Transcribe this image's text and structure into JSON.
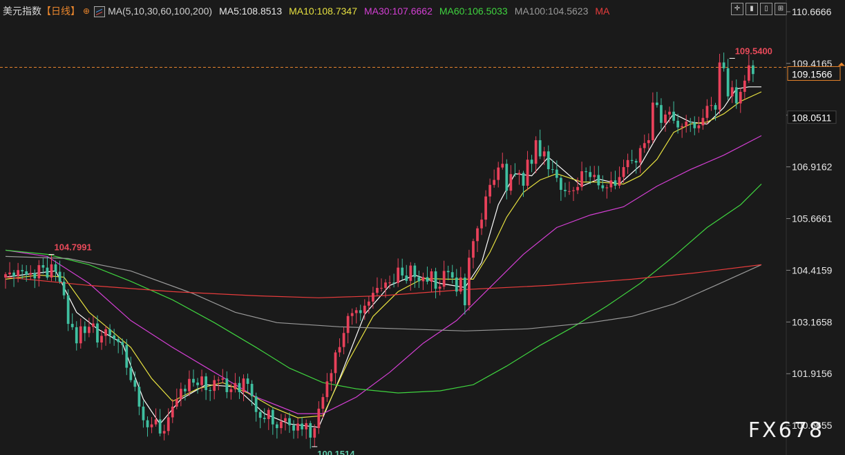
{
  "legend": {
    "symbol": "美元指数",
    "period": "【日线】",
    "gear_icon": "⊕",
    "ma_params": "MA(5,10,30,60,100,200)",
    "ma5": "MA5:108.8513",
    "ma10": "MA10:108.7347",
    "ma30": "MA30:107.6662",
    "ma60": "MA60:106.5033",
    "ma100": "MA100:104.5623",
    "ma200": "MA"
  },
  "toolbar": [
    "crosshair-icon",
    "zoom-in-icon",
    "zoom-out-icon",
    "expand-icon"
  ],
  "watermark": "FX678",
  "colors": {
    "background": "#1a1a1a",
    "up": "#e8415a",
    "down": "#3fbfa0",
    "ma5": "#ffffff",
    "ma10": "#e6e040",
    "ma30": "#d43fd4",
    "ma60": "#3fd43f",
    "ma100": "#9a9a9a",
    "ma200": "#e83c3c",
    "current_line": "#e8852c"
  },
  "chart_data": {
    "type": "candlestick",
    "y_ticks": [
      "110.6666",
      "109.4165",
      "108.1663",
      "106.9162",
      "105.6661",
      "104.4159",
      "103.1658",
      "101.9156",
      "100.6655"
    ],
    "ylim": [
      99.95,
      110.95
    ],
    "current_price": "109.1566",
    "ma_label": "108.0511",
    "ma_label_value": 108.0511,
    "annotations": [
      {
        "text": "104.7991",
        "index": 11,
        "value": 104.7991,
        "kind": "high"
      },
      {
        "text": "100.1514",
        "index": 74,
        "value": 100.1514,
        "kind": "low"
      },
      {
        "text": "109.5400",
        "index": 174,
        "value": 109.54,
        "kind": "high"
      }
    ],
    "candles": {
      "count": 182,
      "open": [
        104.24,
        104.32,
        104.36,
        104.27,
        104.42,
        104.39,
        104.31,
        104.35,
        104.22,
        104.54,
        104.48,
        104.24,
        104.56,
        104.38,
        104.14,
        103.81,
        103.12,
        103.04,
        102.65,
        103.06,
        102.9,
        103.05,
        103.13,
        102.67,
        102.83,
        102.99,
        102.84,
        102.75,
        102.68,
        102.61,
        102.06,
        101.76,
        101.6,
        101.12,
        100.79,
        100.62,
        100.69,
        100.81,
        100.47,
        100.53,
        100.86,
        101.12,
        101.3,
        101.55,
        101.49,
        101.79,
        101.7,
        101.64,
        101.85,
        101.52,
        101.5,
        101.76,
        101.77,
        101.8,
        101.47,
        101.54,
        101.69,
        101.47,
        101.8,
        101.67,
        101.37,
        100.99,
        100.85,
        100.82,
        101.04,
        100.69,
        100.6,
        100.76,
        100.84,
        100.67,
        100.54,
        100.71,
        100.57,
        100.72,
        100.37,
        100.6,
        101.07,
        101.35,
        101.73,
        101.93,
        102.43,
        102.56,
        102.9,
        103.31,
        103.38,
        103.45,
        103.38,
        103.56,
        103.66,
        103.87,
        103.99,
        103.99,
        104.12,
        104.12,
        104.11,
        104.48,
        104.29,
        104.16,
        104.53,
        104.25,
        104.15,
        104.25,
        104.14,
        104.39,
        103.97,
        104.02,
        104.4,
        104.37,
        104.24,
        103.9,
        104.24,
        103.57,
        104.72,
        105.12,
        105.43,
        105.64,
        106.2,
        106.48,
        106.6,
        106.9,
        106.99,
        106.34,
        106.74,
        106.73,
        106.77,
        106.46,
        107.09,
        106.99,
        107.56,
        107.17,
        107.29,
        106.86,
        106.85,
        106.65,
        106.36,
        106.33,
        106.33,
        106.35,
        106.43,
        106.81,
        106.79,
        106.67,
        106.72,
        106.47,
        106.4,
        106.42,
        106.59,
        106.46,
        106.67,
        106.91,
        107.08,
        107.06,
        107.02,
        107.37,
        107.49,
        107.56,
        108.47,
        108.41,
        107.98,
        108.18,
        108.25,
        108.03,
        107.87,
        107.9,
        108.01,
        107.99,
        107.85,
        107.92,
        108.1,
        108.39,
        108.41,
        108.3,
        109.44,
        109.3,
        108.62,
        108.84,
        108.45,
        108.73,
        109.0,
        109.37
      ],
      "close": [
        104.32,
        104.36,
        104.27,
        104.42,
        104.39,
        104.31,
        104.35,
        104.22,
        104.54,
        104.48,
        104.24,
        104.56,
        104.38,
        104.14,
        103.81,
        103.12,
        103.04,
        102.65,
        103.06,
        102.9,
        103.05,
        103.13,
        102.67,
        102.83,
        102.99,
        102.84,
        102.75,
        102.68,
        102.61,
        102.06,
        101.76,
        101.6,
        101.12,
        100.79,
        100.62,
        100.69,
        100.81,
        100.47,
        100.53,
        100.86,
        101.12,
        101.3,
        101.55,
        101.49,
        101.79,
        101.7,
        101.64,
        101.85,
        101.52,
        101.5,
        101.76,
        101.77,
        101.8,
        101.47,
        101.54,
        101.69,
        101.47,
        101.8,
        101.67,
        101.37,
        100.99,
        100.85,
        100.82,
        101.04,
        100.69,
        100.6,
        100.76,
        100.84,
        100.67,
        100.54,
        100.71,
        100.57,
        100.72,
        100.37,
        100.6,
        101.07,
        101.35,
        101.73,
        101.93,
        102.43,
        102.56,
        102.9,
        103.31,
        103.38,
        103.45,
        103.38,
        103.56,
        103.66,
        103.87,
        103.99,
        103.99,
        104.12,
        104.12,
        104.11,
        104.48,
        104.29,
        104.16,
        104.53,
        104.25,
        104.15,
        104.25,
        104.14,
        104.39,
        103.97,
        104.02,
        104.4,
        104.37,
        104.24,
        103.9,
        104.24,
        103.57,
        104.72,
        105.12,
        105.43,
        105.64,
        106.2,
        106.48,
        106.6,
        106.9,
        106.99,
        106.34,
        106.74,
        106.73,
        106.77,
        106.46,
        107.09,
        106.99,
        107.56,
        107.17,
        107.29,
        106.86,
        106.85,
        106.65,
        106.36,
        106.33,
        106.33,
        106.35,
        106.43,
        106.81,
        106.79,
        106.67,
        106.72,
        106.47,
        106.4,
        106.42,
        106.59,
        106.46,
        106.67,
        106.91,
        107.08,
        107.06,
        107.02,
        107.37,
        107.49,
        107.56,
        108.47,
        108.41,
        107.98,
        108.18,
        108.25,
        108.03,
        107.87,
        107.9,
        108.01,
        107.99,
        107.85,
        107.92,
        108.1,
        108.39,
        108.41,
        108.3,
        109.44,
        109.3,
        108.62,
        108.84,
        108.45,
        108.73,
        109.0,
        109.37,
        109.16
      ],
      "highlow": "derived"
    },
    "moving_averages": [
      {
        "name": "MA5",
        "color": "#ffffff",
        "points": [
          [
            0,
            104.25
          ],
          [
            6,
            104.33
          ],
          [
            12,
            104.4
          ],
          [
            17,
            103.4
          ],
          [
            22,
            103.0
          ],
          [
            28,
            102.65
          ],
          [
            33,
            101.3
          ],
          [
            37,
            100.7
          ],
          [
            42,
            101.3
          ],
          [
            48,
            101.65
          ],
          [
            55,
            101.6
          ],
          [
            62,
            100.95
          ],
          [
            68,
            100.7
          ],
          [
            75,
            100.62
          ],
          [
            80,
            101.8
          ],
          [
            86,
            103.35
          ],
          [
            92,
            104.05
          ],
          [
            98,
            104.3
          ],
          [
            104,
            104.1
          ],
          [
            110,
            104.0
          ],
          [
            114,
            104.6
          ],
          [
            118,
            106.0
          ],
          [
            122,
            106.75
          ],
          [
            126,
            106.7
          ],
          [
            130,
            107.15
          ],
          [
            134,
            106.8
          ],
          [
            138,
            106.45
          ],
          [
            142,
            106.62
          ],
          [
            147,
            106.5
          ],
          [
            152,
            106.95
          ],
          [
            156,
            107.65
          ],
          [
            160,
            108.2
          ],
          [
            164,
            108.0
          ],
          [
            168,
            107.95
          ],
          [
            172,
            108.35
          ],
          [
            175,
            108.8
          ],
          [
            178,
            108.85
          ],
          [
            181,
            108.85
          ]
        ]
      },
      {
        "name": "MA10",
        "color": "#e6e040",
        "points": [
          [
            0,
            104.2
          ],
          [
            8,
            104.3
          ],
          [
            14,
            104.25
          ],
          [
            20,
            103.4
          ],
          [
            26,
            102.9
          ],
          [
            30,
            102.55
          ],
          [
            35,
            101.8
          ],
          [
            40,
            101.25
          ],
          [
            46,
            101.55
          ],
          [
            52,
            101.7
          ],
          [
            58,
            101.45
          ],
          [
            64,
            101.1
          ],
          [
            70,
            100.85
          ],
          [
            76,
            100.9
          ],
          [
            82,
            102.2
          ],
          [
            88,
            103.3
          ],
          [
            94,
            103.9
          ],
          [
            100,
            104.22
          ],
          [
            106,
            104.2
          ],
          [
            112,
            104.2
          ],
          [
            116,
            104.85
          ],
          [
            120,
            105.7
          ],
          [
            124,
            106.3
          ],
          [
            128,
            106.6
          ],
          [
            132,
            106.75
          ],
          [
            138,
            106.55
          ],
          [
            142,
            106.55
          ],
          [
            148,
            106.5
          ],
          [
            152,
            106.7
          ],
          [
            156,
            107.1
          ],
          [
            160,
            107.75
          ],
          [
            164,
            107.95
          ],
          [
            168,
            108.0
          ],
          [
            172,
            108.2
          ],
          [
            176,
            108.5
          ],
          [
            181,
            108.73
          ]
        ]
      },
      {
        "name": "MA30",
        "color": "#d43fd4",
        "points": [
          [
            0,
            104.9
          ],
          [
            10,
            104.75
          ],
          [
            20,
            104.1
          ],
          [
            30,
            103.2
          ],
          [
            40,
            102.55
          ],
          [
            50,
            101.95
          ],
          [
            60,
            101.35
          ],
          [
            70,
            100.95
          ],
          [
            76,
            100.95
          ],
          [
            84,
            101.35
          ],
          [
            92,
            101.95
          ],
          [
            100,
            102.65
          ],
          [
            108,
            103.2
          ],
          [
            116,
            104.0
          ],
          [
            124,
            104.8
          ],
          [
            132,
            105.45
          ],
          [
            140,
            105.75
          ],
          [
            148,
            105.95
          ],
          [
            156,
            106.45
          ],
          [
            164,
            106.85
          ],
          [
            172,
            107.2
          ],
          [
            181,
            107.67
          ]
        ]
      },
      {
        "name": "MA60",
        "color": "#3fd43f",
        "points": [
          [
            0,
            104.9
          ],
          [
            10,
            104.8
          ],
          [
            20,
            104.55
          ],
          [
            30,
            104.15
          ],
          [
            40,
            103.7
          ],
          [
            50,
            103.15
          ],
          [
            60,
            102.55
          ],
          [
            68,
            102.05
          ],
          [
            76,
            101.7
          ],
          [
            84,
            101.55
          ],
          [
            94,
            101.45
          ],
          [
            104,
            101.5
          ],
          [
            112,
            101.65
          ],
          [
            120,
            102.1
          ],
          [
            128,
            102.6
          ],
          [
            136,
            103.05
          ],
          [
            144,
            103.55
          ],
          [
            152,
            104.1
          ],
          [
            160,
            104.75
          ],
          [
            168,
            105.45
          ],
          [
            176,
            106.0
          ],
          [
            181,
            106.5
          ]
        ]
      },
      {
        "name": "MA100",
        "color": "#9a9a9a",
        "points": [
          [
            0,
            104.75
          ],
          [
            15,
            104.7
          ],
          [
            30,
            104.4
          ],
          [
            45,
            103.85
          ],
          [
            55,
            103.4
          ],
          [
            65,
            103.15
          ],
          [
            80,
            103.05
          ],
          [
            95,
            103.0
          ],
          [
            110,
            102.95
          ],
          [
            125,
            103.0
          ],
          [
            140,
            103.15
          ],
          [
            150,
            103.3
          ],
          [
            160,
            103.6
          ],
          [
            170,
            104.05
          ],
          [
            181,
            104.55
          ]
        ]
      },
      {
        "name": "MA200",
        "color": "#e83c3c",
        "points": [
          [
            0,
            104.25
          ],
          [
            20,
            104.05
          ],
          [
            40,
            103.9
          ],
          [
            60,
            103.8
          ],
          [
            75,
            103.75
          ],
          [
            90,
            103.8
          ],
          [
            110,
            103.95
          ],
          [
            130,
            104.05
          ],
          [
            150,
            104.2
          ],
          [
            165,
            104.35
          ],
          [
            181,
            104.55
          ]
        ]
      }
    ]
  }
}
